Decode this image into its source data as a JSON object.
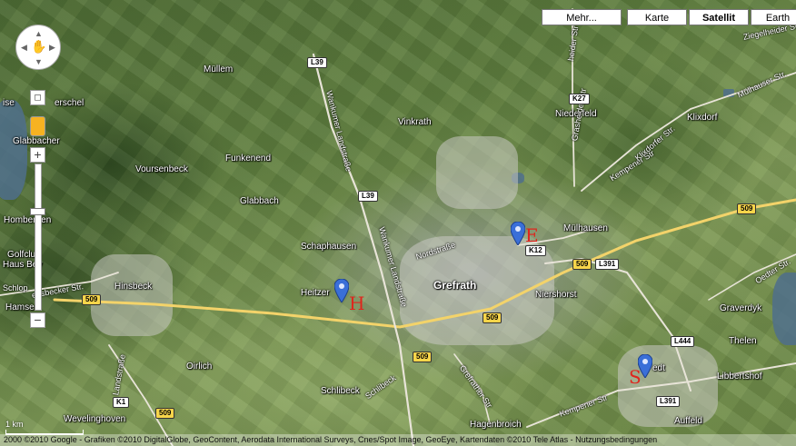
{
  "map_types": {
    "more": "Mehr...",
    "map": "Karte",
    "satellite": "Satellit",
    "earth": "Earth",
    "active": "satellite"
  },
  "places": [
    {
      "id": "muellem",
      "text": "Müllem"
    },
    {
      "id": "herschel",
      "text": "erschel"
    },
    {
      "id": "vinkrath",
      "text": "Vinkrath"
    },
    {
      "id": "niederfeld",
      "text": "Niederfeld"
    },
    {
      "id": "klixdorf",
      "text": "Klixdorf"
    },
    {
      "id": "voursenbeck",
      "text": "Voursenbeck"
    },
    {
      "id": "funkenend",
      "text": "Funkenend"
    },
    {
      "id": "glabbach",
      "text": "Glabbach"
    },
    {
      "id": "hombergen",
      "text": "Hombergen"
    },
    {
      "id": "golfclub",
      "text": "Golfclub"
    },
    {
      "id": "haus-bey",
      "text": "Haus Bey"
    },
    {
      "id": "schaphausen",
      "text": "Schaphausen"
    },
    {
      "id": "muelhausen",
      "text": "Mülhausen"
    },
    {
      "id": "hinsbeck",
      "text": "Hinsbeck"
    },
    {
      "id": "heitzerend",
      "text": "Heitzer"
    },
    {
      "id": "grefrath",
      "text": "Grefrath"
    },
    {
      "id": "niershorst",
      "text": "Niershorst"
    },
    {
      "id": "graverdyk",
      "text": "Graverdyk"
    },
    {
      "id": "thelen",
      "text": "Thelen"
    },
    {
      "id": "hamsel",
      "text": "Hamse"
    },
    {
      "id": "oirlich",
      "text": "Oirlich"
    },
    {
      "id": "schlibeck",
      "text": "Schlibeck"
    },
    {
      "id": "libbertshof",
      "text": "Libbertshof"
    },
    {
      "id": "oedt",
      "text": "edt"
    },
    {
      "id": "hagenbroich",
      "text": "Hagenbroich"
    },
    {
      "id": "auffeld",
      "text": "Auffeld"
    },
    {
      "id": "wevelinghoven",
      "text": "Wevelinghoven"
    },
    {
      "id": "glabbacher",
      "text": "Glabbacher"
    },
    {
      "id": "ise",
      "text": "ise"
    }
  ],
  "streets": [
    {
      "id": "wankumer-1",
      "text": "Wankumer Landstraße"
    },
    {
      "id": "wankumer-2",
      "text": "Wankumer Landstraße"
    },
    {
      "id": "nordstrasse",
      "text": "Nordstraße"
    },
    {
      "id": "schlibeck-str",
      "text": "Schlibeck"
    },
    {
      "id": "grefrather-str",
      "text": "Grefrather Str"
    },
    {
      "id": "kempener-str-1",
      "text": "Kempener Str"
    },
    {
      "id": "kempener-str-2",
      "text": "Kempener Str"
    },
    {
      "id": "klixdorfer-str",
      "text": "Klixdorfer Str."
    },
    {
      "id": "mulhauser-str",
      "text": "Mülhauser Str."
    },
    {
      "id": "oedter-str",
      "text": "Oedter Str."
    },
    {
      "id": "ziegelheider-str",
      "text": "Ziegelheider Str."
    },
    {
      "id": "grasheider-str",
      "text": "Grasheider Str"
    },
    {
      "id": "heider-str",
      "text": "heider Str"
    },
    {
      "id": "landstrasse",
      "text": "Landstraße"
    },
    {
      "id": "hinsbecker-str",
      "text": "ensbecker Str."
    },
    {
      "id": "schlop",
      "text": "Schlop"
    }
  ],
  "shields": [
    {
      "id": "l39-top",
      "text": "L39",
      "style": "white"
    },
    {
      "id": "l39-mid",
      "text": "L39",
      "style": "white"
    },
    {
      "id": "k27",
      "text": "K27",
      "style": "white"
    },
    {
      "id": "k12",
      "text": "K12",
      "style": "white"
    },
    {
      "id": "b509-right",
      "text": "509",
      "style": "yellow"
    },
    {
      "id": "b509-mid",
      "text": "509",
      "style": "yellow"
    },
    {
      "id": "l391-mid",
      "text": "L391",
      "style": "white"
    },
    {
      "id": "b509-left",
      "text": "509",
      "style": "yellow"
    },
    {
      "id": "b509-center",
      "text": "509",
      "style": "yellow"
    },
    {
      "id": "b509-lower",
      "text": "509",
      "style": "yellow"
    },
    {
      "id": "l444",
      "text": "L444",
      "style": "white"
    },
    {
      "id": "l391-bottom",
      "text": "L391",
      "style": "white"
    },
    {
      "id": "k1",
      "text": "K1",
      "style": "white"
    },
    {
      "id": "b509-bottom",
      "text": "509",
      "style": "yellow"
    }
  ],
  "markers": [
    {
      "id": "marker-k12",
      "label": "E"
    },
    {
      "id": "marker-heitzerend",
      "label": "H"
    },
    {
      "id": "marker-oedt",
      "label": "S"
    }
  ],
  "scale": {
    "label": "1 km"
  },
  "attribution": "2000 ©2010 Google - Grafiken ©2010 DigitalGlobe, GeoContent, Aerodata International Surveys, Cnes/Spot Image, GeoEye, Kartendaten ©2010 Tele Atlas - Nutzungsbedingungen",
  "colors": {
    "marker": "#3a6fd8",
    "handwriting": "#e0241c",
    "shield_yellow": "#f7d54a"
  }
}
